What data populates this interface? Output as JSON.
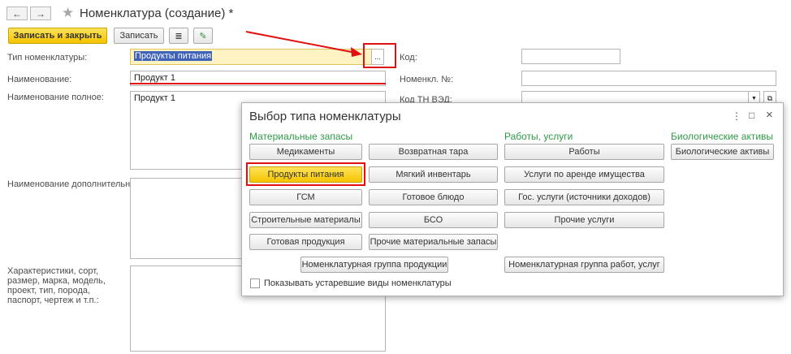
{
  "window": {
    "title": "Номенклатура (создание) *",
    "nav_back": "←",
    "nav_forward": "→",
    "star": "★"
  },
  "toolbar": {
    "save_close": "Записать и закрыть",
    "save": "Записать",
    "report_icon": "≣",
    "edit_icon": "✎"
  },
  "form": {
    "type_label": "Тип номенклатуры:",
    "type_value": "Продукты питания",
    "type_pick_button": "...",
    "name_label": "Наименование:",
    "name_value": "Продукт 1",
    "fullname_label": "Наименование полное:",
    "fullname_value": "Продукт 1",
    "extra_label": "Наименование дополнительное:",
    "chars_label": "Характеристики, сорт, размер, марка, модель, проект, тип, порода, паспорт, чертеж и т.п.:",
    "code_label": "Код:",
    "code_value": "",
    "nomnum_label": "Номенкл. №:",
    "nomnum_value": "",
    "tnved_label": "Код ТН ВЭД:",
    "tnved_value": ""
  },
  "modal": {
    "title": "Выбор типа номенклатуры",
    "menu_icon": "⋮",
    "maximize_icon": "□",
    "close_icon": "×",
    "groups": [
      {
        "heading": "Материальные запасы"
      },
      {
        "heading": "Работы, услуги"
      },
      {
        "heading": "Биологические активы"
      }
    ],
    "col1": [
      "Медикаменты",
      "Продукты питания",
      "ГСМ",
      "Строительные материалы",
      "Готовая продукция"
    ],
    "col2": [
      "Возвратная тара",
      "Мягкий инвентарь",
      "Готовое блюдо",
      "БСО",
      "Прочие материальные запасы"
    ],
    "col3": [
      "Работы",
      "Услуги по аренде имущества",
      "Гос. услуги (источники доходов)",
      "Прочие услуги"
    ],
    "col4": [
      "Биологические активы"
    ],
    "group_products": "Номенклатурная группа продукции",
    "group_works": "Номенклатурная группа работ, услуг",
    "show_obsolete": "Показывать устаревшие виды номенклатуры"
  },
  "colors": {
    "accent_yellow": "#f5c400",
    "heading_green": "#2f9b47",
    "annotation_red": "#e01010",
    "selection_blue": "#3f63b8"
  }
}
